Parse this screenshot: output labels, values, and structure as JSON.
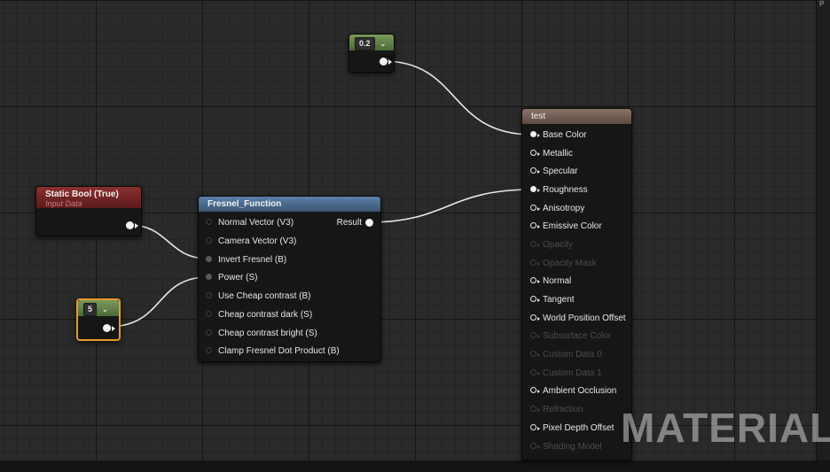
{
  "nodes": {
    "constant_top": {
      "value": "0.2"
    },
    "constant_bottom": {
      "value": "5"
    },
    "static_bool": {
      "title": "Static Bool (True)",
      "subtitle": "Input Data"
    },
    "fresnel": {
      "title": "Fresnel_Function",
      "inputs": [
        "Normal Vector (V3)",
        "Camera Vector (V3)",
        "Invert Fresnel (B)",
        "Power (S)",
        "Use Cheap contrast (B)",
        "Cheap contrast dark (S)",
        "Cheap contrast bright (S)",
        "Clamp Fresnel Dot Product (B)"
      ],
      "output": "Result"
    },
    "material": {
      "title": "test",
      "pins": [
        "Base Color",
        "Metallic",
        "Specular",
        "Roughness",
        "Anisotropy",
        "Emissive Color",
        "Opacity",
        "Opacity Mask",
        "Normal",
        "Tangent",
        "World Position Offset",
        "Subsurface Color",
        "Custom Data 0",
        "Custom Data 1",
        "Ambient Occlusion",
        "Refraction",
        "Pixel Depth Offset",
        "Shading Model"
      ]
    }
  },
  "watermark": "MATERIAL",
  "corner_label": "P",
  "colors": {
    "wire": "#e8e8e8",
    "selection": "#e89a2a",
    "header_red": "#8a2f2f",
    "header_blue": "#5a7fa8",
    "header_brown": "#8a7268",
    "header_green": "#7a9a5a"
  },
  "icons": [
    "chevron-down-icon",
    "pin-filled-icon",
    "pin-open-icon",
    "pin-arrow-icon"
  ]
}
